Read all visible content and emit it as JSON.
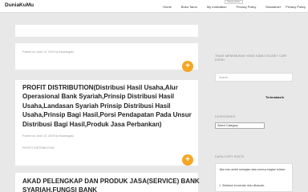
{
  "header": {
    "brand": "DuniaKuMu",
    "nav": [
      "Home",
      "Buku Tamu",
      "My motivation",
      "Privacy Policy",
      "Disclaimer",
      "Privacy Policy"
    ],
    "translate_label": "Diterjemahkan"
  },
  "posts": [
    {
      "meta": ""
    },
    {
      "meta": "Posted on June 13, 2019 by ihsaningaki"
    },
    {
      "title": "PROFIT DISTRIBUTION(Distribusi Hasil Usaha,Alur Operasional Bank Syariah,Prinsip Distribusi Hasil Usaha,Landasan Syariah Prinsip Distribusi Hasil Usaha,Prinsip Bagi Hasil,Porsi Pendapatan Pada Unsur Distribusi Bagi Hasil,Produk Jasa Perbankan)",
      "meta": "Posted on June 13, 2019 by ihsaningaki",
      "category": "PROFIT DISTRIBUTION"
    },
    {
      "title": "AKAD PELENGKAP DAN PRODUK JASA(SERVICE) BANK SYARIAH,FUNGSI BANK"
    }
  ],
  "sidebar": {
    "search_title": "TIDAK MENEMUKAN YANG KAMU DICARI? CARI DISINI",
    "search_placeholder": "Search ...",
    "brand_small": "Terimakasih",
    "categories_title": "CATEGORIES",
    "categories_select": "Select Category",
    "copy_title": "CARA COPY PASTE",
    "copy_text_1": "Jika mau ambil sebagian atau semua bagian tulisan",
    "copy_text_2": "1. Silahkan komentar dulu dibawah,"
  },
  "colors": {
    "accent": "#f5a623",
    "background": "#e8e8e8"
  }
}
